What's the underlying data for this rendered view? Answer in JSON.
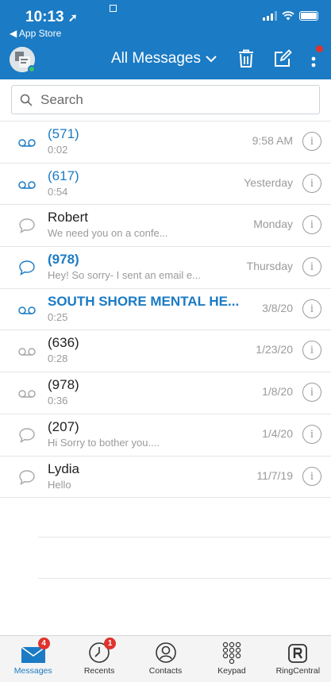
{
  "status_bar": {
    "time": "10:13",
    "back_label": "◀ App Store"
  },
  "header": {
    "title": "All Messages",
    "accent": "#1b7bc4"
  },
  "search": {
    "placeholder": "Search"
  },
  "messages": [
    {
      "name": "(571)",
      "sub": "0:02",
      "time": "9:58 AM",
      "type": "voicemail",
      "unread": true
    },
    {
      "name": "(617)",
      "sub": "0:54",
      "time": "Yesterday",
      "type": "voicemail",
      "unread": true
    },
    {
      "name": "Robert",
      "sub": "We need you on a confe...",
      "time": "Monday",
      "type": "text",
      "unread": false
    },
    {
      "name": "(978)",
      "sub": "Hey! So sorry- I sent an email e...",
      "time": "Thursday",
      "type": "text",
      "unread": true
    },
    {
      "name": "SOUTH SHORE MENTAL HE...",
      "sub": "0:25",
      "time": "3/8/20",
      "type": "voicemail",
      "unread": true
    },
    {
      "name": "(636)",
      "sub": "0:28",
      "time": "1/23/20",
      "type": "voicemail",
      "unread": false
    },
    {
      "name": "(978)",
      "sub": "0:36",
      "time": "1/8/20",
      "type": "voicemail",
      "unread": false
    },
    {
      "name": "(207)",
      "sub": "Hi        Sorry to bother you....",
      "time": "1/4/20",
      "type": "text",
      "unread": false
    },
    {
      "name": "Lydia",
      "sub": "Hello",
      "time": "11/7/19",
      "type": "text",
      "unread": false
    }
  ],
  "tabs": [
    {
      "label": "Messages",
      "badge": "4",
      "icon": "envelope-icon",
      "active": true
    },
    {
      "label": "Recents",
      "badge": "1",
      "icon": "clock-icon",
      "active": false
    },
    {
      "label": "Contacts",
      "badge": "",
      "icon": "contact-icon",
      "active": false
    },
    {
      "label": "Keypad",
      "badge": "",
      "icon": "keypad-icon",
      "active": false
    },
    {
      "label": "RingCentral",
      "badge": "",
      "icon": "ringcentral-icon",
      "active": false
    }
  ]
}
